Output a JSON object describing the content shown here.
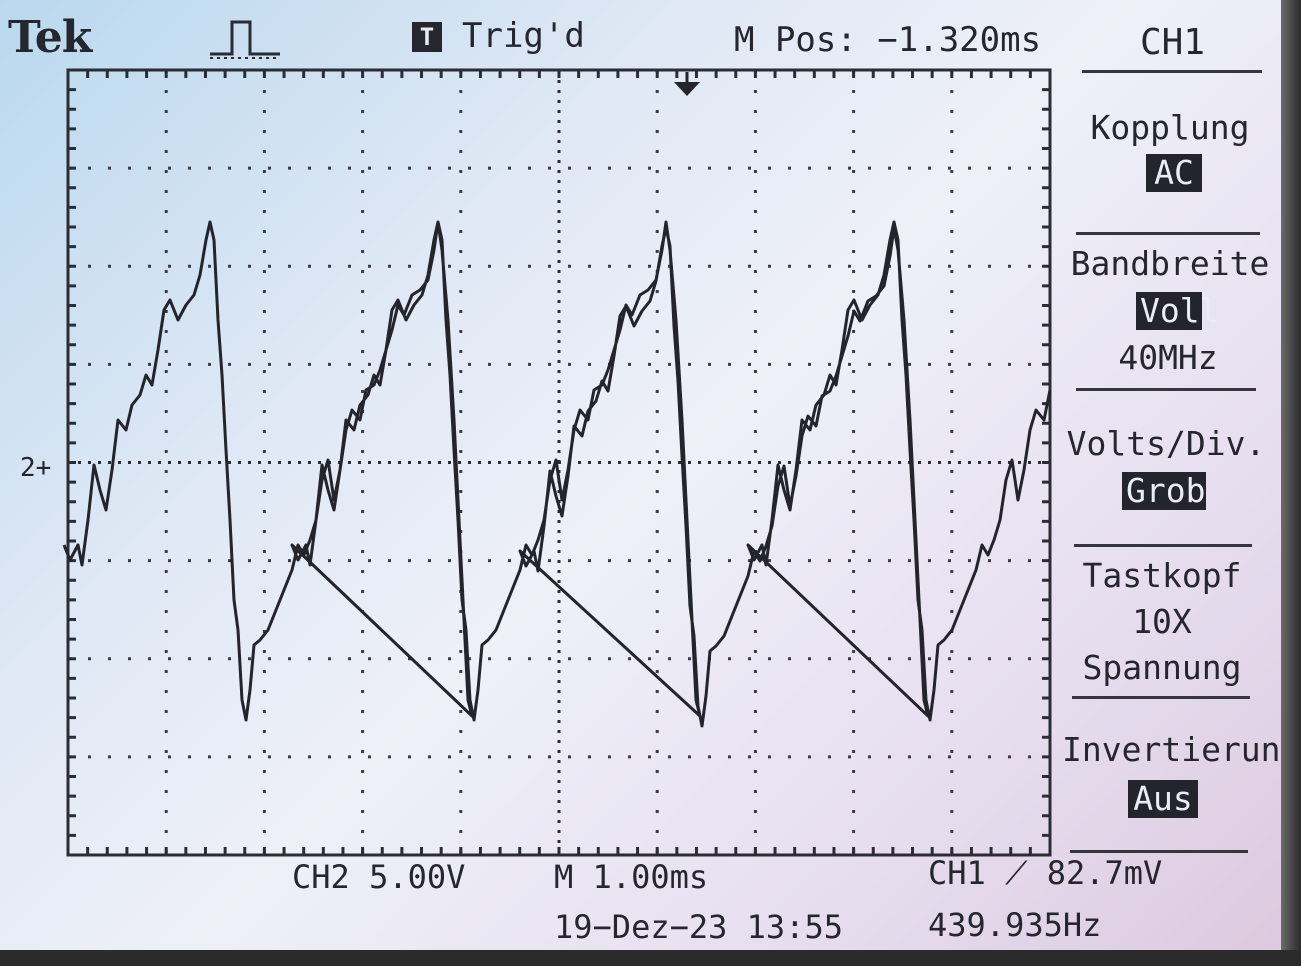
{
  "header": {
    "brand": "Tek",
    "trigger_icon": "T",
    "trigger_status": "Trig'd",
    "m_pos": "M Pos: −1.320ms",
    "channel": "CH1"
  },
  "menu": {
    "kopplung": {
      "label": "Kopplung",
      "value": "AC"
    },
    "bandbreite": {
      "label": "Bandbreite",
      "value": "Voll",
      "sub": "40MHz"
    },
    "volts_div": {
      "label": "Volts/Div.",
      "value": "Grob"
    },
    "tastkopf": {
      "label": "Tastkopf",
      "value": "10X",
      "sub": "Spannung"
    },
    "invertierung": {
      "label": "Invertierung",
      "value": "Aus"
    }
  },
  "footer": {
    "ch2_scale": "CH2  5.00V",
    "timebase": "M 1.00ms",
    "trigger_level": "CH1 ⟋ 82.7mV",
    "datetime": "19−Dez−23 13:55",
    "frequency": "439.935Hz"
  },
  "marker": {
    "ch2": "2+"
  },
  "colors": {
    "trace": "#23242c",
    "screen": "#e4ebf6",
    "highlight": "#23242c"
  }
}
